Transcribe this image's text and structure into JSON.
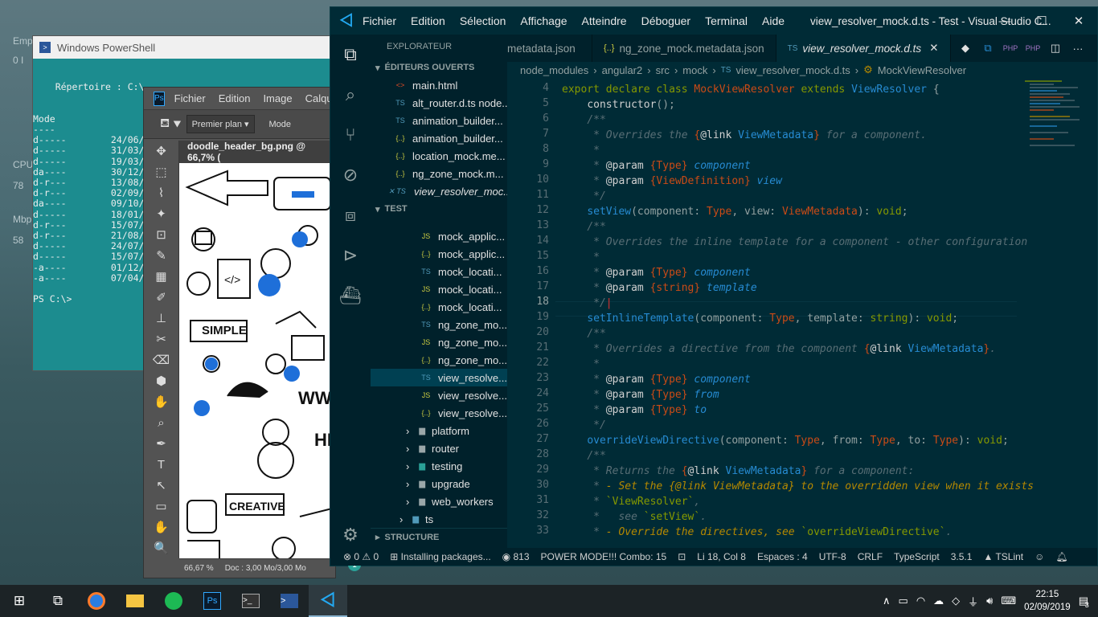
{
  "desktop": {
    "fragments": [
      "Emp",
      "0 I",
      "CPU",
      "78",
      "Mbp",
      "58"
    ]
  },
  "powershell": {
    "title": "Windows PowerShell",
    "lines": [
      "",
      "    Répertoire : C:\\",
      "",
      "",
      "Mode",
      "----",
      "d-----        24/06/2",
      "d-----        31/03/2",
      "d-----        19/03/2",
      "da----        30/12/2",
      "d-r---        13/08/2",
      "d-r---        02/09/2",
      "da----        09/10/2",
      "d-----        18/01/2",
      "d-r---        15/07/2",
      "d-r---        21/08/2",
      "d-----        24/07/2",
      "d-----        15/07/2",
      "-a----        01/12/2",
      "-a----        07/04/2",
      "",
      "PS C:\\>"
    ]
  },
  "photoshop": {
    "logo": "Ps",
    "menu": [
      "Fichier",
      "Edition",
      "Image",
      "Calque"
    ],
    "option_dropdown": "Premier plan",
    "mode_label": "Mode",
    "doc_tab": "doodle_header_bg.png @ 66,7% (",
    "zoom": "66,67 %",
    "doc_info": "Doc : 3,00 Mo/3,00 Mo",
    "canvas_words": [
      "SIMPLE",
      "CREATIVE",
      "WW",
      "HI",
      "</>"
    ],
    "tools": [
      "✥",
      "⬚",
      "⌇",
      "✦",
      "⊡",
      "✎",
      "▦",
      "✐",
      "⊥",
      "✂",
      "⌫",
      "⬢",
      "✋",
      "⌕",
      "✒",
      "T",
      "↖",
      "▭",
      "✋",
      "🔍"
    ]
  },
  "vscode": {
    "title": "view_resolver_mock.d.ts - Test - Visual Studio C...",
    "menu": [
      "Fichier",
      "Edition",
      "Sélection",
      "Affichage",
      "Atteindre",
      "Déboguer",
      "Terminal",
      "Aide"
    ],
    "explorer_header": "EXPLORATEUR",
    "open_editors_label": "ÉDITEURS OUVERTS",
    "test_label": "TEST",
    "structure_label": "STRUCTURE",
    "open_editors": [
      {
        "icon": "<>",
        "name": "main.html",
        "color": "#e44d26"
      },
      {
        "icon": "TS",
        "name": "alt_router.d.ts  node...",
        "color": "#519aba"
      },
      {
        "icon": "TS",
        "name": "animation_builder...",
        "color": "#519aba"
      },
      {
        "icon": "{..}",
        "name": "animation_builder...",
        "color": "#cbcb41"
      },
      {
        "icon": "{..}",
        "name": "location_mock.me...",
        "color": "#cbcb41"
      },
      {
        "icon": "{..}",
        "name": "ng_zone_mock.m...",
        "color": "#cbcb41"
      },
      {
        "icon": "✕ TS",
        "name": "view_resolver_moc...",
        "color": "#519aba"
      }
    ],
    "tree": [
      {
        "icon": "JS",
        "name": "mock_applic...",
        "color": "#cbcb41"
      },
      {
        "icon": "{..}",
        "name": "mock_applic...",
        "color": "#cbcb41"
      },
      {
        "icon": "TS",
        "name": "mock_locati...",
        "color": "#519aba"
      },
      {
        "icon": "JS",
        "name": "mock_locati...",
        "color": "#cbcb41"
      },
      {
        "icon": "{..}",
        "name": "mock_locati...",
        "color": "#cbcb41"
      },
      {
        "icon": "TS",
        "name": "ng_zone_mo...",
        "color": "#519aba"
      },
      {
        "icon": "JS",
        "name": "ng_zone_mo...",
        "color": "#cbcb41"
      },
      {
        "icon": "{..}",
        "name": "ng_zone_mo...",
        "color": "#cbcb41"
      },
      {
        "icon": "TS",
        "name": "view_resolve...",
        "color": "#519aba"
      },
      {
        "icon": "JS",
        "name": "view_resolve...",
        "color": "#cbcb41"
      },
      {
        "icon": "{..}",
        "name": "view_resolve...",
        "color": "#cbcb41"
      }
    ],
    "folders": [
      "platform",
      "router",
      "testing",
      "upgrade",
      "web_workers",
      "ts"
    ],
    "tabs": [
      "metadata.json",
      "ng_zone_mock.metadata.json",
      "view_resolver_mock.d.ts"
    ],
    "breadcrumb": [
      "node_modules",
      "angular2",
      "src",
      "mock",
      "view_resolver_mock.d.ts",
      "MockViewResolver"
    ],
    "line_numbers": [
      "4",
      "5",
      "6",
      "7",
      "8",
      "9",
      "10",
      "11",
      "12",
      "13",
      "14",
      "15",
      "16",
      "17",
      "18",
      "19",
      "20",
      "21",
      "22",
      "23",
      "24",
      "25",
      "26",
      "27",
      "28",
      "29",
      "30",
      "31",
      "32",
      "33"
    ],
    "status": {
      "errors": "0",
      "warnings": "0",
      "task": "Installing packages...",
      "views": "813",
      "power": "POWER MODE!!! Combo: 15",
      "pos": "Li 18, Col 8",
      "spaces": "Espaces : 4",
      "enc": "UTF-8",
      "eol": "CRLF",
      "lang": "TypeScript",
      "ver": "3.5.1",
      "lint": "TSLint",
      "badge": "1"
    }
  },
  "taskbar": {
    "time": "22:15",
    "date": "02/09/2019",
    "notif": "3",
    "ps_label": "Ps"
  }
}
